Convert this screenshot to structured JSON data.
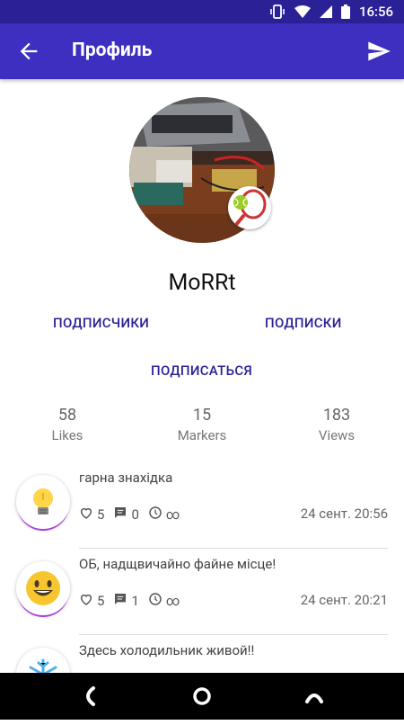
{
  "status_bar": {
    "time": "16:56"
  },
  "app_bar": {
    "title": "Профиль"
  },
  "profile": {
    "username": "MoRRt",
    "followers_link": "ПОДПИСЧИКИ",
    "following_link": "ПОДПИСКИ",
    "subscribe_link": "ПОДПИСАТЬСЯ"
  },
  "stats": [
    {
      "value": "58",
      "label": "Likes"
    },
    {
      "value": "15",
      "label": "Markers"
    },
    {
      "value": "183",
      "label": "Views"
    }
  ],
  "posts": [
    {
      "text": "гарна знахідка",
      "icon": "lightbulb-icon",
      "likes": "5",
      "comments": "0",
      "duration": "∞",
      "date": "24 сент. 20:56"
    },
    {
      "text": "ОБ, надщвичайно файне місце!",
      "icon": "smiley-icon",
      "likes": "5",
      "comments": "1",
      "duration": "∞",
      "date": "24 сент. 20:21"
    },
    {
      "text": "Здесь холодильник живой!!",
      "icon": "snowflake-icon"
    }
  ],
  "colors": {
    "primary": "#3d2fbf",
    "status_bar": "#2b2196",
    "accent": "#a93fd9"
  }
}
